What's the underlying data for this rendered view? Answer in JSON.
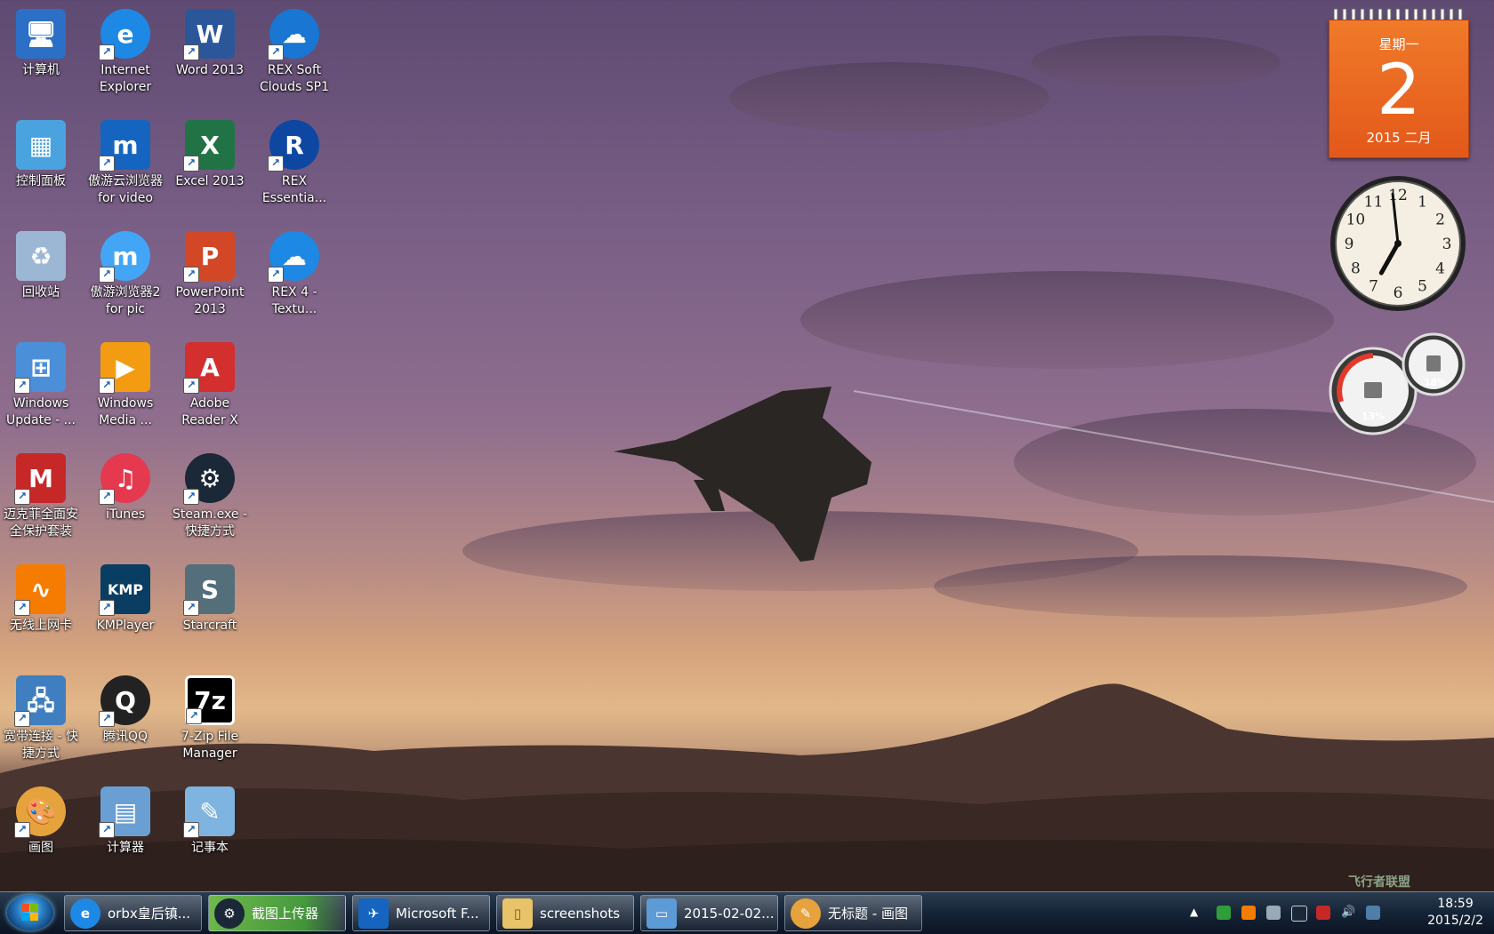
{
  "desktop_icons": [
    {
      "label": "计算机",
      "icon": "computer-icon",
      "color": "#2b6fc7"
    },
    {
      "label": "Internet Explorer",
      "icon": "internet-explorer-icon",
      "color": "#1e88e5"
    },
    {
      "label": "Word 2013",
      "icon": "word-icon",
      "color": "#2b579a"
    },
    {
      "label": "REX Soft Clouds SP1",
      "icon": "rex-clouds-icon",
      "color": "#1976d2"
    },
    {
      "label": "控制面板",
      "icon": "control-panel-icon",
      "color": "#4aa3df"
    },
    {
      "label": "傲游云浏览器 for video",
      "icon": "maxthon-icon",
      "color": "#1565c0"
    },
    {
      "label": "Excel 2013",
      "icon": "excel-icon",
      "color": "#217346"
    },
    {
      "label": "REX Essentia...",
      "icon": "rex-essential-icon",
      "color": "#0d47a1"
    },
    {
      "label": "回收站",
      "icon": "recycle-bin-icon",
      "color": "#9bb7d4"
    },
    {
      "label": "傲游浏览器2 for pic",
      "icon": "maxthon2-icon",
      "color": "#42a5f5"
    },
    {
      "label": "PowerPoint 2013",
      "icon": "powerpoint-icon",
      "color": "#d24726"
    },
    {
      "label": "REX 4 - Textu...",
      "icon": "rex-textures-icon",
      "color": "#1e88e5"
    },
    {
      "label": "Windows Update - ...",
      "icon": "windows-update-icon",
      "color": "#4a8fd8"
    },
    {
      "label": "Windows Media ...",
      "icon": "windows-media-icon",
      "color": "#f39c12"
    },
    {
      "label": "Adobe Reader X",
      "icon": "adobe-reader-icon",
      "color": "#d32f2f"
    },
    {
      "label": "迈克菲全面安全保护套装",
      "icon": "mcafee-icon",
      "color": "#c62828"
    },
    {
      "label": "iTunes",
      "icon": "itunes-icon",
      "color": "#e53950"
    },
    {
      "label": "Steam.exe - 快捷方式",
      "icon": "steam-icon",
      "color": "#1b2838"
    },
    {
      "label": "无线上网卡",
      "icon": "wireless-card-icon",
      "color": "#f57c00"
    },
    {
      "label": "KMPlayer",
      "icon": "kmplayer-icon",
      "color": "#0a3d62"
    },
    {
      "label": "Starcraft",
      "icon": "starcraft-icon",
      "color": "#546e7a"
    },
    {
      "label": "宽带连接 - 快捷方式",
      "icon": "broadband-icon",
      "color": "#3f7fbf"
    },
    {
      "label": "腾讯QQ",
      "icon": "qq-icon",
      "color": "#222222"
    },
    {
      "label": "7-Zip File Manager",
      "icon": "7zip-icon",
      "color": "#000000"
    },
    {
      "label": "画图",
      "icon": "paint-icon",
      "color": "#e6a23c"
    },
    {
      "label": "计算器",
      "icon": "calculator-icon",
      "color": "#6a9fd4"
    },
    {
      "label": "记事本",
      "icon": "notepad-icon",
      "color": "#7fb3e0"
    }
  ],
  "taskbar": {
    "items": [
      {
        "label": "orbx皇后镇...",
        "icon": "internet-explorer-icon",
        "active": false
      },
      {
        "label": "截图上传器",
        "icon": "steam-icon",
        "active": true
      },
      {
        "label": "Microsoft F...",
        "icon": "airplane-icon",
        "active": false
      },
      {
        "label": "screenshots",
        "icon": "folder-icon",
        "active": false
      },
      {
        "label": "2015-02-02...",
        "icon": "image-viewer-icon",
        "active": false
      },
      {
        "label": "无标题 - 画图",
        "icon": "paint-icon",
        "active": false
      }
    ],
    "clock_time": "18:59",
    "clock_date": "2015/2/2"
  },
  "gadgets": {
    "calendar": {
      "weekday": "星期一",
      "day": "2",
      "year_month": "2015 二月"
    },
    "clock": {
      "numerals": [
        "12",
        "1",
        "2",
        "3",
        "4",
        "5",
        "6",
        "7",
        "8",
        "9",
        "10",
        "11"
      ],
      "hour": 6,
      "minute": 59
    },
    "meter": {
      "cpu": "13%",
      "memory": "18%"
    }
  },
  "watermark": "飞行者联盟"
}
